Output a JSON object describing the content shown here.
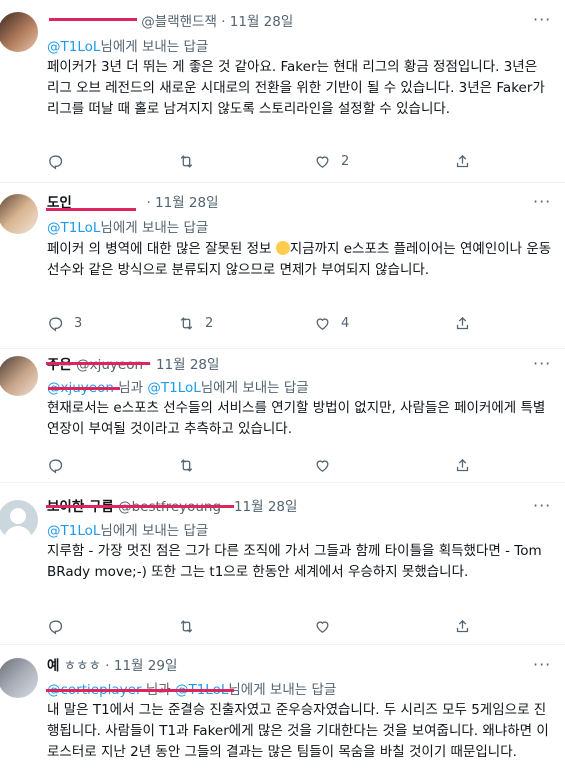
{
  "colors": {
    "accent": "#1d9bf0",
    "muted": "#536471",
    "redaction": "#e0245e"
  },
  "tweets": [
    {
      "handle": "@블랙핸드잭",
      "date": "11월 28일",
      "reply_line": {
        "users": "@T1LoL",
        "suffix": "님에게 보내는 답글"
      },
      "text": "페이커가 3년 더 뛰는 게 좋은 것 같아요. Faker는 현대 리그의 황금 정점입니다. 3년은 리그 오브 레전드의 새로운 시대로의 전환을 위한 기반이 될 수 있습니다. 3년은 Faker가 리그를 떠날 때 홀로 남겨지지 않도록 스토리라인을 설정할 수 있습니다.",
      "reply_count": "",
      "retweet_count": "",
      "like_count": "2"
    },
    {
      "name": "도인",
      "date": "11월 28일",
      "reply_line": {
        "users": "@T1LoL",
        "suffix": "님에게 보내는 답글"
      },
      "text_before": "페이커 의 병역에 대한 많은 잘못된 정보",
      "text_after": "지금까지 e스포츠 플레이어는 연예인이나 운동선수와 같은 방식으로 분류되지 않으므로 면제가 부여되지 않습니다.",
      "reply_count": "3",
      "retweet_count": "2",
      "like_count": "4"
    },
    {
      "name": "주은",
      "handle": "@xjuyeon",
      "date": "11월 28일",
      "reply_line": {
        "users": "@xjuyeon",
        "mid": " 님과 ",
        "users2": "@T1LoL",
        "suffix": "님에게 보내는 답글"
      },
      "text": "현재로서는 e스포츠 선수들의 서비스를 연기할 방법이 없지만, 사람들은 페이커에게 특별 연장이 부여될 것이라고 추측하고 있습니다.",
      "reply_count": "",
      "retweet_count": "",
      "like_count": ""
    },
    {
      "name": "보이한 구름",
      "handle": "@bestfreyoung",
      "date": "11월 28일",
      "reply_line": {
        "users": "@T1LoL",
        "suffix": "님에게 보내는 답글"
      },
      "text": "지루함 - 가장 멋진 점은 그가 다른 조직에 가서 그들과 함께 타이틀을 획득했다면 - Tom BRady move;-) 또한 그는 t1으로 한동안 세계에서 우승하지 못했습니다.",
      "reply_count": "",
      "retweet_count": "",
      "like_count": ""
    },
    {
      "name": "예",
      "handle": "ㅎㅎㅎ",
      "date": "11월 29일",
      "reply_line": {
        "users": "@cortieplayer",
        "mid": " 님과 ",
        "users2": "@T1LoL",
        "suffix": "님에게 보내는 답글"
      },
      "text": "내 말은 T1에서 그는 준결승 진출자였고 준우승자였습니다. 두 시리즈 모두 5게임으로 진행됩니다. 사람들이 T1과 Faker에게 많은 것을 기대한다는 것을 보여줍니다. 왜냐하면 이 로스터로 지난 2년 동안 그들의 결과는 많은 팀들이 목숨을 바칠 것이기 때문입니다.",
      "reply_count": "",
      "retweet_count": "",
      "like_count": ""
    }
  ]
}
